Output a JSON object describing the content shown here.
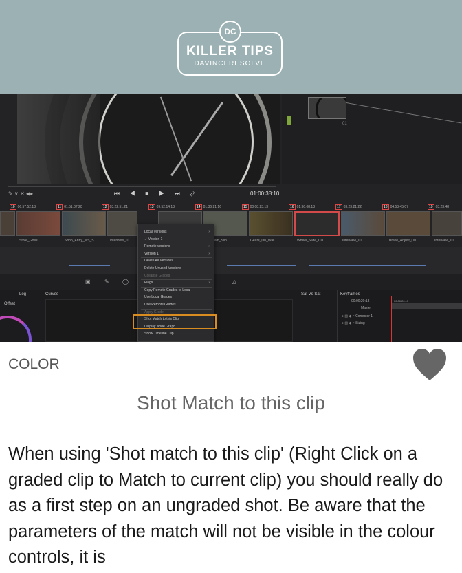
{
  "header": {
    "logo_badge": "DC",
    "logo_title": "KILLER TIPS",
    "logo_subtitle": "DAVINCI RESOLVE"
  },
  "screenshot": {
    "timecode": "01:00:38:10",
    "playback_controls": "⏮ ◀ ■ ▶ ⏭ ⇄",
    "tools_left": "✎ ∨ ✕ ◀▸",
    "node_number": "01",
    "clips_tc": [
      {
        "num": "10",
        "tc": "06:57:52:13"
      },
      {
        "num": "11",
        "tc": "01:51:07:20"
      },
      {
        "num": "12",
        "tc": "03:22:51:21"
      },
      {
        "num": "13",
        "tc": "09:52:14:13"
      },
      {
        "num": "14",
        "tc": "01:36:21:16"
      },
      {
        "num": "15",
        "tc": "00:08:23:13"
      },
      {
        "num": "16",
        "tc": "01:36:08:13"
      },
      {
        "num": "17",
        "tc": "03:23:21:22"
      },
      {
        "num": "18",
        "tc": "04:53:45:07"
      },
      {
        "num": "19",
        "tc": "03:23:48"
      }
    ],
    "clip_names": [
      "Store_Goes",
      "Shop_Entry_MS_S",
      "Interview_01",
      "n_Chain_Slip",
      "Gears_On_Wall",
      "Wheel_Slide_CU",
      "Interview_01",
      "Brake_Adjust_On",
      "Interview_01"
    ],
    "context_menu": {
      "items": [
        {
          "label": "Local Versions",
          "dim": false,
          "arrow": true
        },
        {
          "label": "✓ Version 1",
          "dim": false,
          "arrow": false
        },
        {
          "label": "Remote versions",
          "dim": false,
          "arrow": true
        },
        {
          "label": "Version 1",
          "dim": false,
          "arrow": true
        },
        {
          "label": "Delete All Versions",
          "dim": false,
          "arrow": false
        },
        {
          "label": "Delete Unused Versions",
          "dim": false,
          "arrow": false
        },
        {
          "label": "Collapse Grades",
          "dim": true,
          "arrow": false
        },
        {
          "label": "Flags",
          "dim": false,
          "arrow": true
        },
        {
          "label": "Copy Remote Grades to Local",
          "dim": false,
          "arrow": false
        },
        {
          "label": "Use Local Grades",
          "dim": false,
          "arrow": false
        },
        {
          "label": "Use Remote Grades",
          "dim": false,
          "arrow": false
        },
        {
          "label": "Apply Grade",
          "dim": true,
          "arrow": false
        },
        {
          "label": "Shot Match to this Clip",
          "dim": false,
          "arrow": false
        },
        {
          "label": "Display Node Graph",
          "dim": false,
          "arrow": false
        },
        {
          "label": "Show Timeline Clip",
          "dim": false,
          "arrow": false
        }
      ]
    },
    "panel": {
      "log_label": "Log",
      "curves_label": "Curves",
      "offset_label": "Offset",
      "sat_label": "Sat Vs Sat",
      "keyframes_label": "Keyframes",
      "key_tc": "00:00:20:13",
      "key_tc2": "00:00:20:13",
      "key_master": "Master",
      "key_corrector": "Corrector 1",
      "key_sizing": "Sizing"
    }
  },
  "article": {
    "category": "COLOR",
    "title": "Shot Match to this clip",
    "body": "When using 'Shot match to this clip' (Right Click on a graded clip to Match to current clip) you should really do as a first step on an ungraded shot. Be aware that the parameters of the match will not be visible in the colour controls, it is"
  },
  "colors": {
    "header_bg": "#9bb1b3",
    "highlight_box": "#d98c1f",
    "selected_clip": "#d24a4a",
    "heart": "#666666"
  }
}
